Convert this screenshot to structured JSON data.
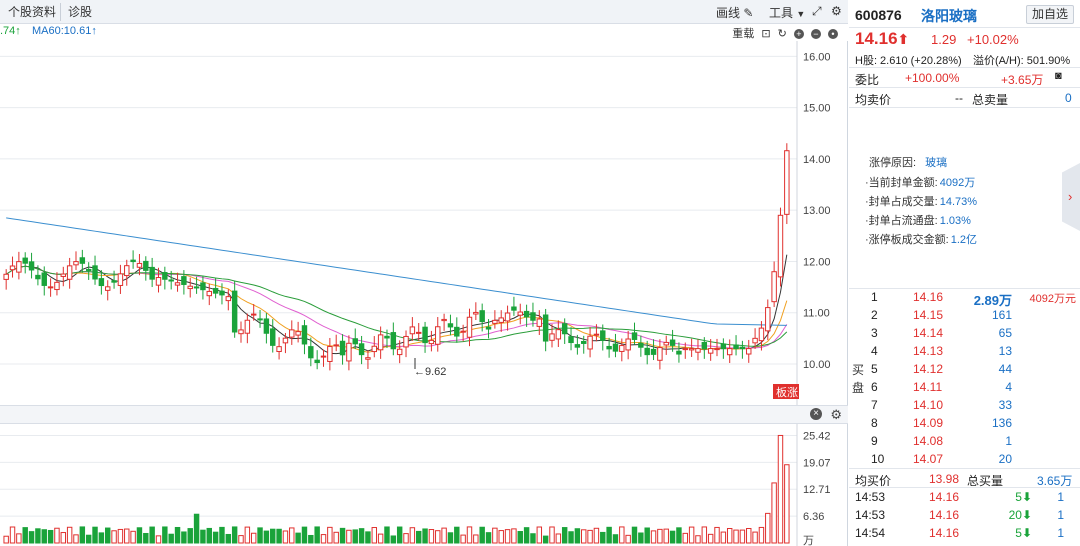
{
  "topbar": {
    "tabs": [
      "个股资料",
      "诊股"
    ],
    "tools": {
      "draw": "画线",
      "tools": "工具"
    }
  },
  "mabar": {
    "ma_partial": ".74↑",
    "ma60": "MA60:10.61↑",
    "subtools": {
      "reset": "重载"
    }
  },
  "chart_data": {
    "type": "candlestick",
    "price_axis": [
      "16.00",
      "15.00",
      "14.00",
      "13.00",
      "12.00",
      "11.00",
      "10.00"
    ],
    "ylim": [
      9.2,
      16.3
    ],
    "low_annotation": "←9.62",
    "badge": "板涨",
    "volume_axis": [
      "25.42",
      "19.07",
      "12.71",
      "6.36",
      "万"
    ]
  },
  "stock": {
    "code": "600876",
    "name": "洛阳玻璃",
    "add_label": "加自选",
    "price": "14.16",
    "change": "1.29",
    "pct": "+10.02%",
    "h_share": "H股: 2.610 (+20.28%)",
    "premium": "溢价(A/H): 501.90%",
    "weibi_label": "委比",
    "weibi_val": "+100.00%",
    "weicha": "+3.65万",
    "avg_sell_label": "均卖价",
    "avg_sell_val": "--",
    "total_sell_label": "总卖量",
    "total_sell_val": "0"
  },
  "limit_reason": {
    "title": "涨停原因:",
    "value": "玻璃",
    "items": [
      {
        "label": "当前封单金额:",
        "value": "4092万"
      },
      {
        "label": "封单占成交量:",
        "value": "14.73%"
      },
      {
        "label": "封单占流通盘:",
        "value": "1.03%"
      },
      {
        "label": "涨停板成交金额:",
        "value": "1.2亿"
      }
    ]
  },
  "order_book": {
    "side_label": "买盘",
    "rows": [
      {
        "n": "1",
        "price": "14.16",
        "vol": "2.89万",
        "extra": "4092万元"
      },
      {
        "n": "2",
        "price": "14.15",
        "vol": "161",
        "extra": ""
      },
      {
        "n": "3",
        "price": "14.14",
        "vol": "65",
        "extra": ""
      },
      {
        "n": "4",
        "price": "14.13",
        "vol": "13",
        "extra": ""
      },
      {
        "n": "5",
        "price": "14.12",
        "vol": "44",
        "extra": ""
      },
      {
        "n": "6",
        "price": "14.11",
        "vol": "4",
        "extra": ""
      },
      {
        "n": "7",
        "price": "14.10",
        "vol": "33",
        "extra": ""
      },
      {
        "n": "8",
        "price": "14.09",
        "vol": "136",
        "extra": ""
      },
      {
        "n": "9",
        "price": "14.08",
        "vol": "1",
        "extra": ""
      },
      {
        "n": "10",
        "price": "14.07",
        "vol": "20",
        "extra": ""
      }
    ],
    "avg_buy_label": "均买价",
    "avg_buy_val": "13.98",
    "total_buy_label": "总买量",
    "total_buy_val": "3.65万"
  },
  "trades": [
    {
      "time": "14:53",
      "price": "14.16",
      "vol": "5",
      "count": "1"
    },
    {
      "time": "14:53",
      "price": "14.16",
      "vol": "20",
      "count": "1"
    },
    {
      "time": "14:54",
      "price": "14.16",
      "vol": "5",
      "count": "1"
    }
  ]
}
